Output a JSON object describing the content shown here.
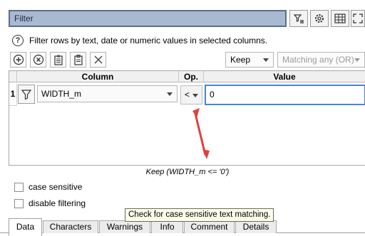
{
  "filter_bar": {
    "label": "Filter"
  },
  "help": {
    "icon_text": "?",
    "text": "Filter rows by text, date or numeric values in selected columns."
  },
  "toolbar": {
    "mode_value": "Keep",
    "match_value": "Matching any (OR)"
  },
  "table": {
    "headers": {
      "column": "Column",
      "op": "Op.",
      "value": "Value"
    },
    "rows": [
      {
        "num": "1",
        "column": "WIDTH_m",
        "op": "<",
        "value": "0"
      }
    ]
  },
  "summary": "Keep (WIDTH_m <= '0')",
  "options": {
    "case_sensitive": "case sensitive",
    "disable_filtering": "disable filtering"
  },
  "tooltip": "Check for case sensitive text matching.",
  "tabs": [
    {
      "label": "Data",
      "active": true
    },
    {
      "label": "Characters"
    },
    {
      "label": "Warnings"
    },
    {
      "label": "Info"
    },
    {
      "label": "Comment"
    },
    {
      "label": "Details"
    }
  ],
  "colors": {
    "accent": "#4a83d3",
    "arrow": "#e0413f",
    "filter_bar": "#a9b9d1"
  },
  "icons": [
    "filter-settings-icon",
    "gear-icon",
    "table-icon",
    "expand-icon",
    "add-icon",
    "remove-icon",
    "paste-icon",
    "copy-icon",
    "clear-icon",
    "funnel-icon"
  ]
}
